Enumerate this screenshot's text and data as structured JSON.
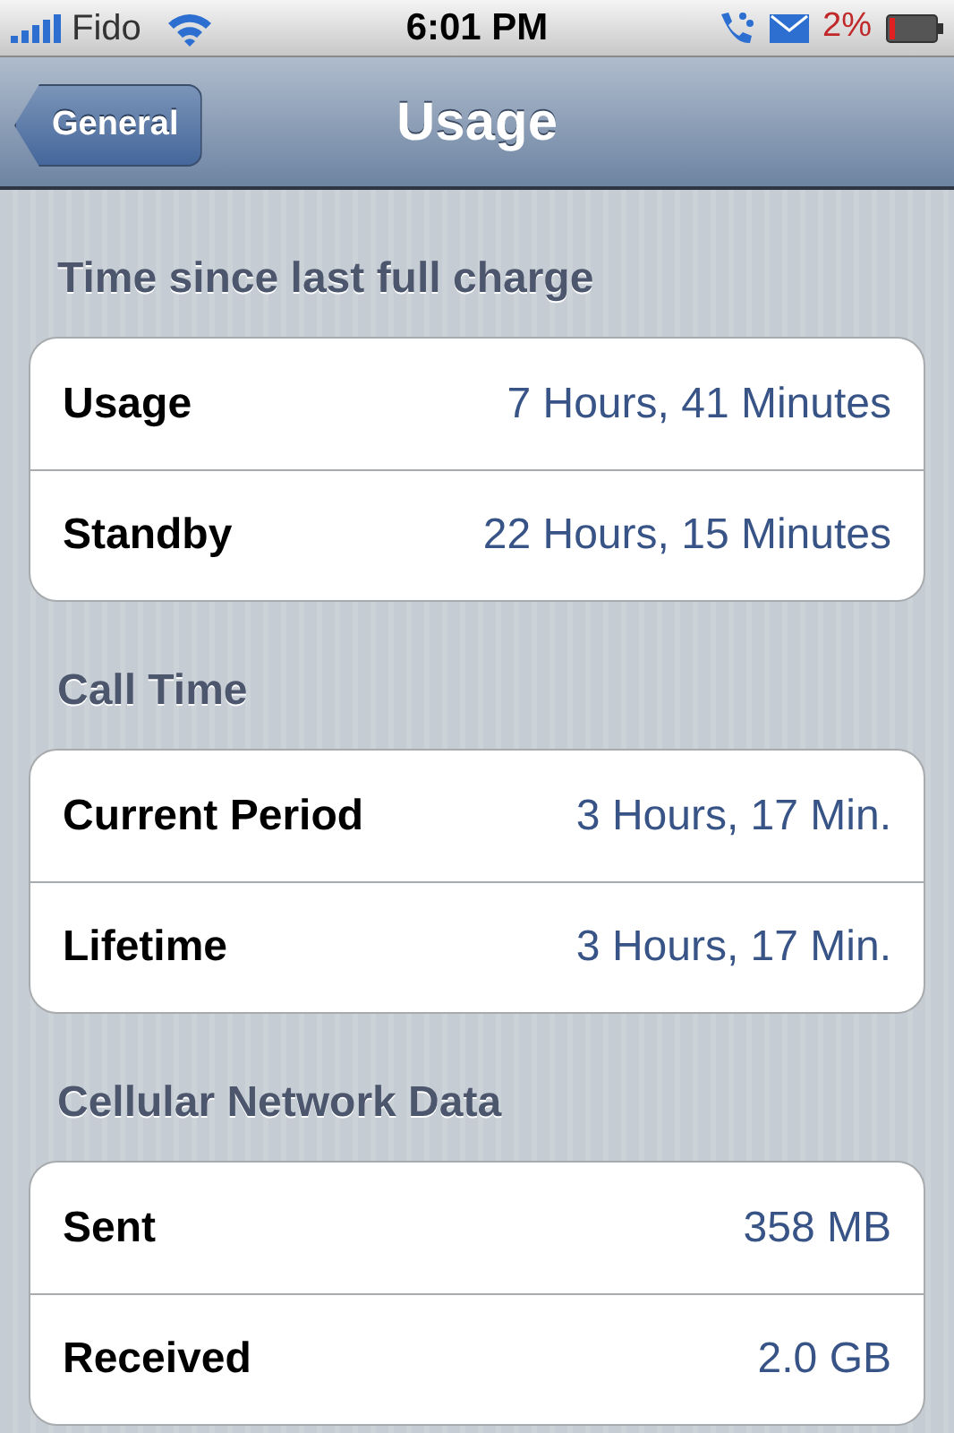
{
  "status_bar": {
    "carrier": "Fido",
    "time": "6:01 PM",
    "battery_percent": "2%"
  },
  "nav_bar": {
    "back_button": "General",
    "title": "Usage"
  },
  "sections": [
    {
      "header": "Time since last full charge",
      "rows": [
        {
          "label": "Usage",
          "value": "7 Hours, 41 Minutes"
        },
        {
          "label": "Standby",
          "value": "22 Hours, 15 Minutes"
        }
      ]
    },
    {
      "header": "Call Time",
      "rows": [
        {
          "label": "Current Period",
          "value": "3 Hours, 17 Min."
        },
        {
          "label": "Lifetime",
          "value": "3 Hours, 17 Min."
        }
      ]
    },
    {
      "header": "Cellular Network Data",
      "rows": [
        {
          "label": "Sent",
          "value": "358 MB"
        },
        {
          "label": "Received",
          "value": "2.0 GB"
        }
      ]
    }
  ]
}
